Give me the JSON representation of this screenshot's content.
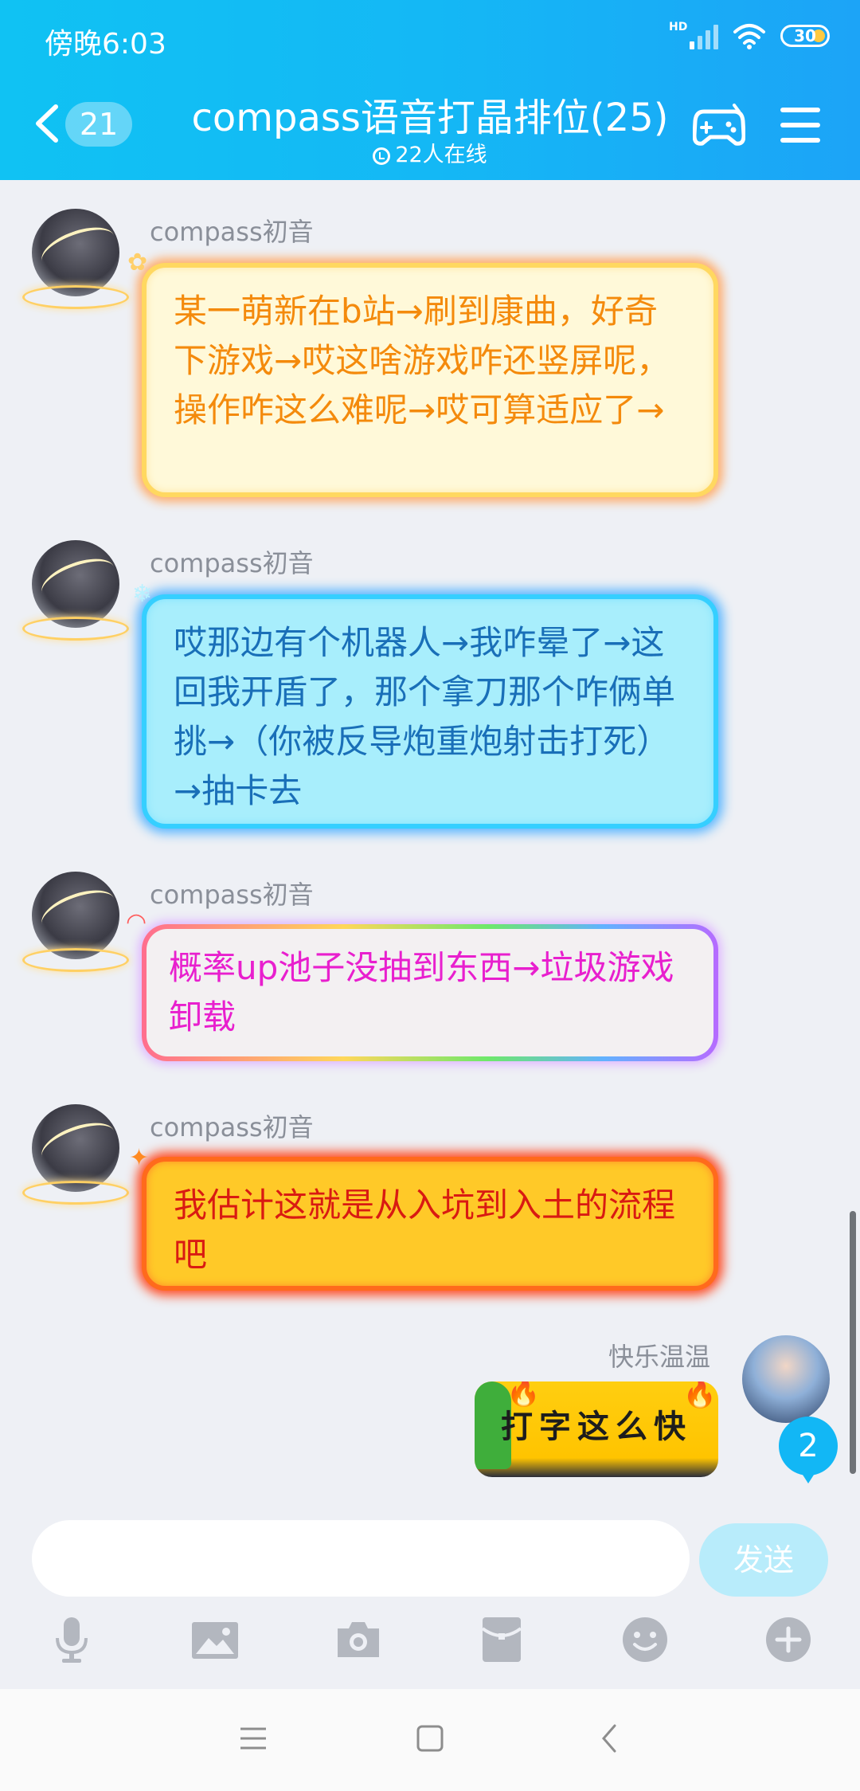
{
  "status_bar": {
    "time": "傍晚6:03",
    "hd": "HD",
    "battery": "30"
  },
  "header": {
    "unread_count": "21",
    "title": "compass语音打晶排位(25)",
    "online": "22人在线"
  },
  "messages": [
    {
      "sender": "compass初音",
      "text": "某一萌新在b站→刷到康曲，好奇下游戏→哎这啥游戏咋还竖屏呢，操作咋这么难呢→哎可算适应了→"
    },
    {
      "sender": "compass初音",
      "text": "哎那边有个机器人→我咋晕了→这回我开盾了，那个拿刀那个咋俩单挑→（你被反导炮重炮射击打死）→抽卡去"
    },
    {
      "sender": "compass初音",
      "text": "概率up池子没抽到东西→垃圾游戏卸载"
    },
    {
      "sender": "compass初音",
      "text": "我估计这就是从入坑到入土的流程吧"
    }
  ],
  "my_message": {
    "sender": "快乐温温",
    "sticker_text": "打字这么快"
  },
  "new_message_badge": "2",
  "input": {
    "value": "",
    "placeholder": "",
    "send_label": "发送"
  },
  "colors": {
    "header": "#14b8f5",
    "send_disabled": "#b8ecfb",
    "badge": "#12b7f5"
  }
}
